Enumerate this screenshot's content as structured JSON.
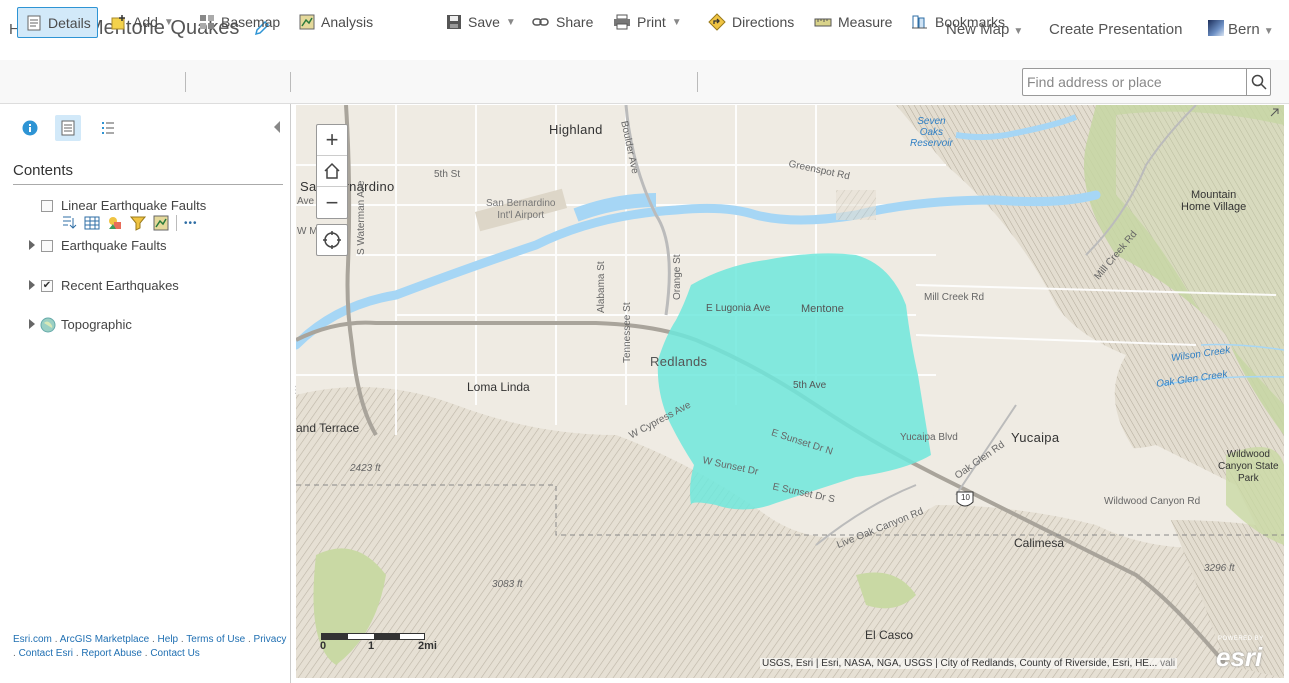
{
  "header": {
    "home_label": "Home",
    "map_title": "Mentone Quakes",
    "new_map_label": "New Map",
    "create_presentation_label": "Create Presentation",
    "user_name": "Bern"
  },
  "toolbar": {
    "details": "Details",
    "add": "Add",
    "basemap": "Basemap",
    "analysis": "Analysis",
    "save": "Save",
    "share": "Share",
    "print": "Print",
    "directions": "Directions",
    "measure": "Measure",
    "bookmarks": "Bookmarks",
    "search_placeholder": "Find address or place"
  },
  "panel": {
    "contents_title": "Contents",
    "layers": [
      {
        "label": "Linear Earthquake Faults",
        "checked": false,
        "expandable": false
      },
      {
        "label": "Earthquake Faults",
        "checked": false,
        "expandable": true
      },
      {
        "label": "Recent Earthquakes",
        "checked": true,
        "expandable": true
      },
      {
        "label": "Topographic",
        "checked": false,
        "expandable": true
      }
    ],
    "layer_tool_more": "•••",
    "footer_links": [
      "Esri.com",
      "ArcGIS Marketplace",
      "Help",
      "Terms of Use",
      "Privacy",
      "Contact Esri",
      "Report Abuse",
      "Contact Us"
    ],
    "footer_sep": "."
  },
  "map": {
    "labels": {
      "highland": "Highland",
      "san_bernardino": "San Bernardino",
      "airport": "San Bernardino\nInt'l Airport",
      "fifth_st": "5th St",
      "boulder_ave": "Boulder Ave",
      "greenspot": "Greenspot Rd",
      "seven_oaks": "Seven\nOaks\nReservoir",
      "mountain_home": "Mountain\nHome Village",
      "mill_creek": "Mill Creek Rd",
      "mill_creek_2": "Mill Creek Rd",
      "waterman": "S Waterman Ave",
      "alabama": "Alabama St",
      "orange": "Orange St",
      "tennessee": "Tennessee St",
      "e_lugonia": "E Lugonia Ave",
      "mentone": "Mentone",
      "redlands": "Redlands",
      "fifth_ave": "5th Ave",
      "loma_linda": "Loma Linda",
      "grand_terrace": "and Terrace",
      "w_cypress": "W Cypress Ave",
      "e_sunset_n": "E Sunset Dr N",
      "w_sunset": "W Sunset Dr",
      "e_sunset_s": "E Sunset Dr S",
      "yucaipa_blvd": "Yucaipa Blvd",
      "yucaipa": "Yucaipa",
      "oak_glen": "Oak Glen Rd",
      "wilson_creek": "Wilson Creek",
      "oak_glen_creek": "Oak Glen Creek",
      "wildwood_park": "Wildwood\nCanyon State\nPark",
      "wildwood_rd": "Wildwood Canyon Rd",
      "elev_2423": "2423 ft",
      "elev_3083": "3083 ft",
      "elev_3296": "3296 ft",
      "live_oak": "Live Oak Canyon Rd",
      "calimesa": "Calimesa",
      "el_casco": "El Casco",
      "i10": "10",
      "sa_label": "S A",
      "wm_label": "W M",
      "ave_label": "Ave"
    },
    "zoom_in": "+",
    "zoom_out": "−",
    "scale_labels": [
      "0",
      "1",
      "2mi"
    ],
    "attribution": "USGS, Esri | Esri, NASA, NGA, USGS | City of Redlands, County of Riverside, Esri, HE...",
    "attribution_tail": "vali",
    "esri_powered": "POWERED BY",
    "esri_logo": "esri"
  },
  "colors": {
    "accent": "#2e94d4",
    "quake_area": "#6fe8dc",
    "water": "#a6d6f5",
    "terrain": "#eee9df",
    "vegetation": "#c9d9a4"
  }
}
